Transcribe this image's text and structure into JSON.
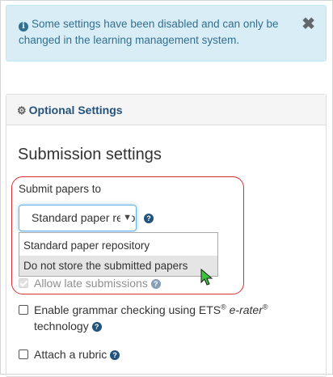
{
  "alert": {
    "message": "Some settings have been disabled and can only be changed in the learning management system."
  },
  "panel": {
    "heading": "Optional Settings",
    "section_title": "Submission settings"
  },
  "submit_papers": {
    "label": "Submit papers to",
    "selected": "Standard paper repository",
    "options": [
      "Standard paper repository",
      "Do not store the submitted papers"
    ],
    "hovered_option_index": 1
  },
  "options": {
    "late_submissions": {
      "label": "Allow late submissions",
      "checked": true,
      "disabled": true
    },
    "grammar": {
      "label_prefix": "Enable grammar checking using ETS",
      "reg": "®",
      "label_em": "e-rater",
      "label_suffix": "technology",
      "checked": false
    },
    "rubric": {
      "label": "Attach a rubric",
      "checked": false
    }
  },
  "colors": {
    "alert_bg": "#d9edf7",
    "alert_text": "#31708f",
    "link": "#23527c",
    "highlight_ring": "#d9302c",
    "cursor_green": "#3cc43c"
  },
  "icons": {
    "alert": "info-circle-icon",
    "close": "close-icon",
    "heading": "gear-icon",
    "help": "question-circle-icon",
    "select": "chevron-down-icon",
    "pointer": "mouse-pointer-icon"
  }
}
